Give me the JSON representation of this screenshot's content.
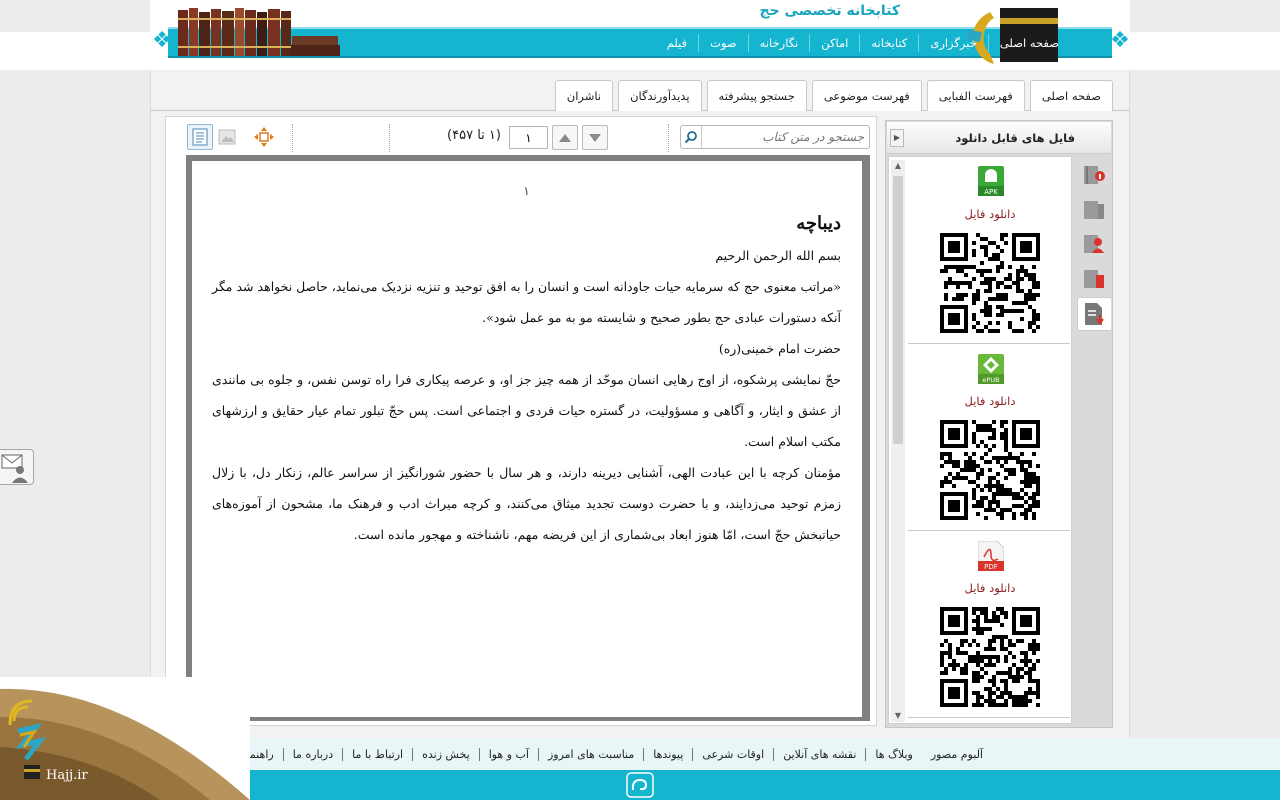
{
  "header": {
    "site_title": "کتابخانه تخصصی حج",
    "nav": [
      "صفحه اصلی",
      "خبرگزاری",
      "کتابخانه",
      "اماکن",
      "نگارخانه",
      "صوت",
      "فیلم"
    ]
  },
  "tabs": [
    "صفحه اصلی",
    "فهرست الفبایی",
    "فهرست موضوعی",
    "جستجو پیشرفته",
    "پدیدآورندگان",
    "ناشران"
  ],
  "toolbar": {
    "search_placeholder": "جستجو در متن کتاب",
    "page_value": "۱",
    "page_total": "(۱ تا ۴۵۷)"
  },
  "page": {
    "number": "۱",
    "title": "دیباچه",
    "paragraphs": [
      "بسم الله الرحمن الرحیم",
      "«مراتب معنوی حج که سرمایه حیات جاودانه است و انسان را به افق توحید و تنزیه نزدیک می‌نماید، حاصل نخواهد شد مگر آنکه دستورات عبادی حج بطور صحیح و شایسته مو به مو عمل شود».",
      "حضرت امام خمینی(ره)",
      "حجّ نمایشی پرشکوه، از اوج رهایی انسان موحّد از همه چیز جز او، و عرصه پیکاری فرا راه توسن نفس، و جلوه بی مانندی از عشق و ایثار، و آگاهی و مسؤولیت، در گستره حیات فردی و اجتماعی است. پس حجّ تبلور تمام عیار حقایق و ارزشهای مکتب اسلام است.",
      "مؤمنان کرچه با این عبادت الهی، آشنایی دیرینه دارند، و هر سال با حضور شورانگیز از سراسر عالم، زنکار دل، با زلال زمزم توحید می‌زدایند، و با حضرت دوست تجدید میثاق می‌کنند، و کرچه میراث ادب و فرهنک ما، مشحون از آموزه‌های حیاتبخش حجّ است، امّا هنوز ابعاد بی‌شماری از این فریضه مهم، ناشناخته و مهجور مانده است."
    ]
  },
  "side_panel": {
    "title": "فایل های قابل دانلود",
    "downloads": [
      {
        "type": "APK",
        "label": "دانلود فایل",
        "color": "#3aa836"
      },
      {
        "type": "ePUB",
        "label": "دانلود فایل",
        "color": "#6ab83a"
      },
      {
        "type": "PDF",
        "label": "دانلود فایل",
        "color": "#d9342b"
      }
    ]
  },
  "footer": {
    "links": [
      "راهنما",
      "درباره ما",
      "ارتباط با ما",
      "پخش زنده",
      "آب و هوا",
      "مناسبت های امروز",
      "پیوندها",
      "اوقات شرعی",
      "نقشه های آنلاین",
      "وبلاگ ها",
      "آلبوم مصور"
    ],
    "brand": "Hajj.ir"
  },
  "colors": {
    "accent": "#15b5cf",
    "link_dark_red": "#8b1c1c"
  }
}
